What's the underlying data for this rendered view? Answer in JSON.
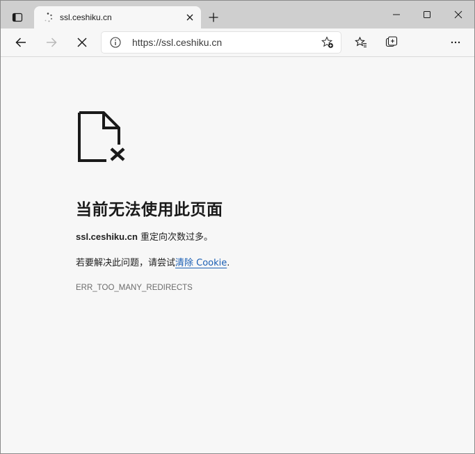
{
  "tab": {
    "title": "ssl.ceshiku.cn",
    "status": "loading"
  },
  "address_bar": {
    "url": "https://ssl.ceshiku.cn"
  },
  "icons": {
    "tab_actions": "tab-actions-icon",
    "spinner": "loading-spinner-icon",
    "tab_close": "close-icon",
    "new_tab": "plus-icon",
    "minimize": "minimize-icon",
    "maximize": "maximize-icon",
    "window_close": "close-icon",
    "back": "back-arrow-icon",
    "forward": "forward-arrow-icon",
    "stop": "stop-icon",
    "site_info": "info-icon",
    "add_favorite": "star-plus-icon",
    "favorites": "favorites-icon",
    "collections": "collections-icon",
    "profile": "avatar",
    "more": "more-icon",
    "error_page": "broken-page-icon"
  },
  "error": {
    "title": "当前无法使用此页面",
    "host": "ssl.ceshiku.cn",
    "message": " 重定向次数过多。",
    "hint_prefix": "若要解决此问题，请尝试",
    "hint_link": "清除 Cookie",
    "hint_suffix": ".",
    "code": "ERR_TOO_MANY_REDIRECTS"
  },
  "colors": {
    "titlebar_bg": "#cfcfcf",
    "page_bg": "#f7f7f7",
    "link": "#1a5fb4",
    "error_code": "#6b6b6b"
  }
}
